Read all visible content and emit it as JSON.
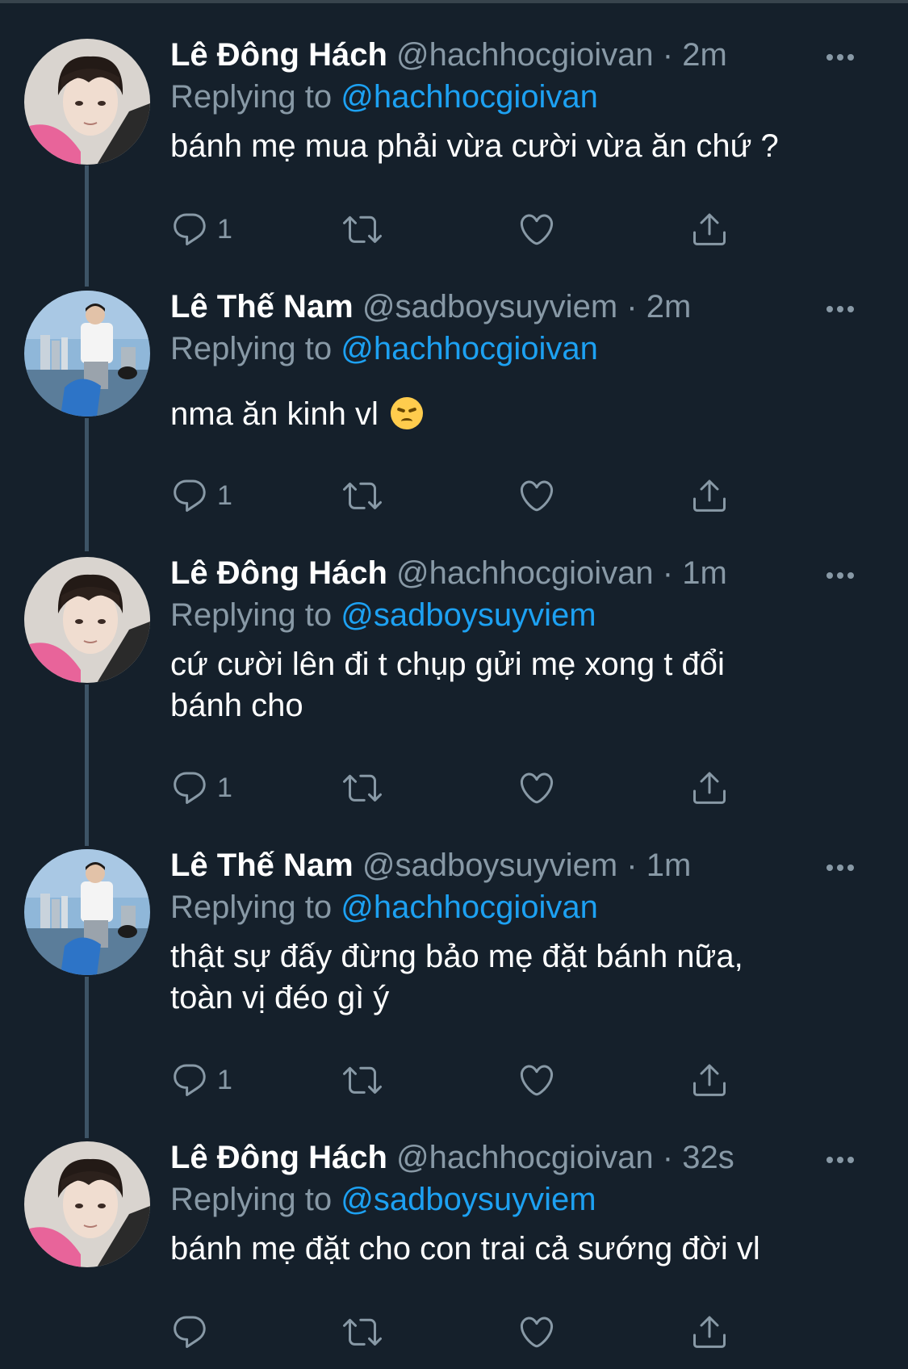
{
  "tweets": [
    {
      "name": "Lê Đông Hách",
      "handle": "@hachhocgioivan",
      "time": "2m",
      "replying_label": "Replying to",
      "reply_to": "@hachhocgioivan",
      "text": "bánh mẹ mua phải vừa cười vừa ăn chứ ?",
      "reply_count": "1",
      "avatar": "avatar-pink-hoodie"
    },
    {
      "name": "Lê Thế Nam",
      "handle": "@sadboysuyviem",
      "time": "2m",
      "replying_label": "Replying to",
      "reply_to": "@hachhocgioivan",
      "text": "nma ăn kinh vl",
      "emoji": "disappointed-face",
      "reply_count": "1",
      "avatar": "avatar-sea-city"
    },
    {
      "name": "Lê Đông Hách",
      "handle": "@hachhocgioivan",
      "time": "1m",
      "replying_label": "Replying to",
      "reply_to": "@sadboysuyviem",
      "text_line1": "cứ cười lên đi t chụp gửi mẹ xong t đổi",
      "text_line2": "bánh cho",
      "reply_count": "1",
      "avatar": "avatar-pink-hoodie"
    },
    {
      "name": "Lê Thế Nam",
      "handle": "@sadboysuyviem",
      "time": "1m",
      "replying_label": "Replying to",
      "reply_to": "@hachhocgioivan",
      "text_line1": "thật sự đấy đừng bảo mẹ đặt bánh nữa,",
      "text_line2": "toàn vị đéo gì ý",
      "reply_count": "1",
      "avatar": "avatar-sea-city"
    },
    {
      "name": "Lê Đông Hách",
      "handle": "@hachhocgioivan",
      "time": "32s",
      "replying_label": "Replying to",
      "reply_to": "@sadboysuyviem",
      "text": "bánh mẹ đặt cho con trai cả sướng đời vl",
      "reply_count": "",
      "avatar": "avatar-pink-hoodie"
    }
  ],
  "icons": [
    "reply-icon",
    "retweet-icon",
    "like-icon",
    "share-icon",
    "more-options-icon"
  ],
  "colors": {
    "background": "#15202b",
    "secondary_text": "#8899a6",
    "mention": "#1da1f2",
    "thread_line": "#3d5466"
  }
}
